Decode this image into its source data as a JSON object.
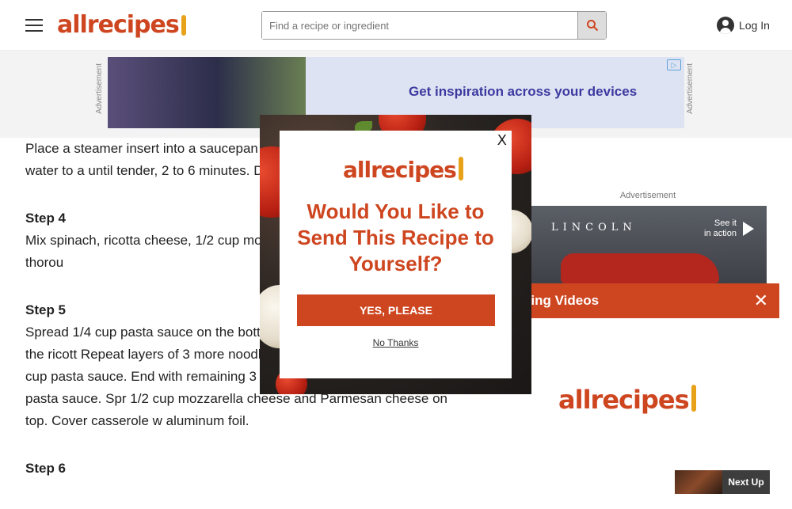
{
  "header": {
    "logo_text": "allrecipes",
    "search_placeholder": "Find a recipe or ingredient",
    "login_label": "Log In"
  },
  "ads": {
    "side_label": "Advertisement",
    "banner_text": "Get inspiration across your devices",
    "adchoice": "▷",
    "right_label": "Advertisement",
    "video_brand": "LINCOLN",
    "video_tagline": "See it\nin action"
  },
  "article": {
    "steps": [
      {
        "title": "",
        "text": "Place a steamer insert into a saucepan a bottom of the steamer. Bring water to a until tender, 2 to 6 minutes. Drain spinac"
      },
      {
        "title": "Step 4",
        "text": "Mix spinach, ricotta cheese, 1/2 cup moz and black pepper in a bowl until thorou"
      },
      {
        "title": "Step 5",
        "text": "Spread 1/4 cup pasta sauce on the botto with 3 lasagna noodles, 1/2 of the ricott Repeat layers of 3 more noodles, 1/2 cup ricotta mixture, and 1/4 cup pasta sauce. End with remaining 3 lasagna noodles and 1/4 cup pasta sauce. Spr 1/2 cup mozzarella cheese and Parmesan cheese on top. Cover casserole w aluminum foil."
      },
      {
        "title": "Step 6",
        "text": ""
      }
    ]
  },
  "trending": {
    "label": "ding Videos",
    "logo_text": "allrecipes"
  },
  "next_up": {
    "label": "Next Up"
  },
  "modal": {
    "close_label": "X",
    "logo_text": "allrecipes",
    "title": "Would You Like to Send This Recipe to Yourself?",
    "cta_label": "YES, PLEASE",
    "decline_label": "No Thanks"
  },
  "colors": {
    "brand": "#ce4620",
    "logo_spoon": "#e8a219"
  }
}
